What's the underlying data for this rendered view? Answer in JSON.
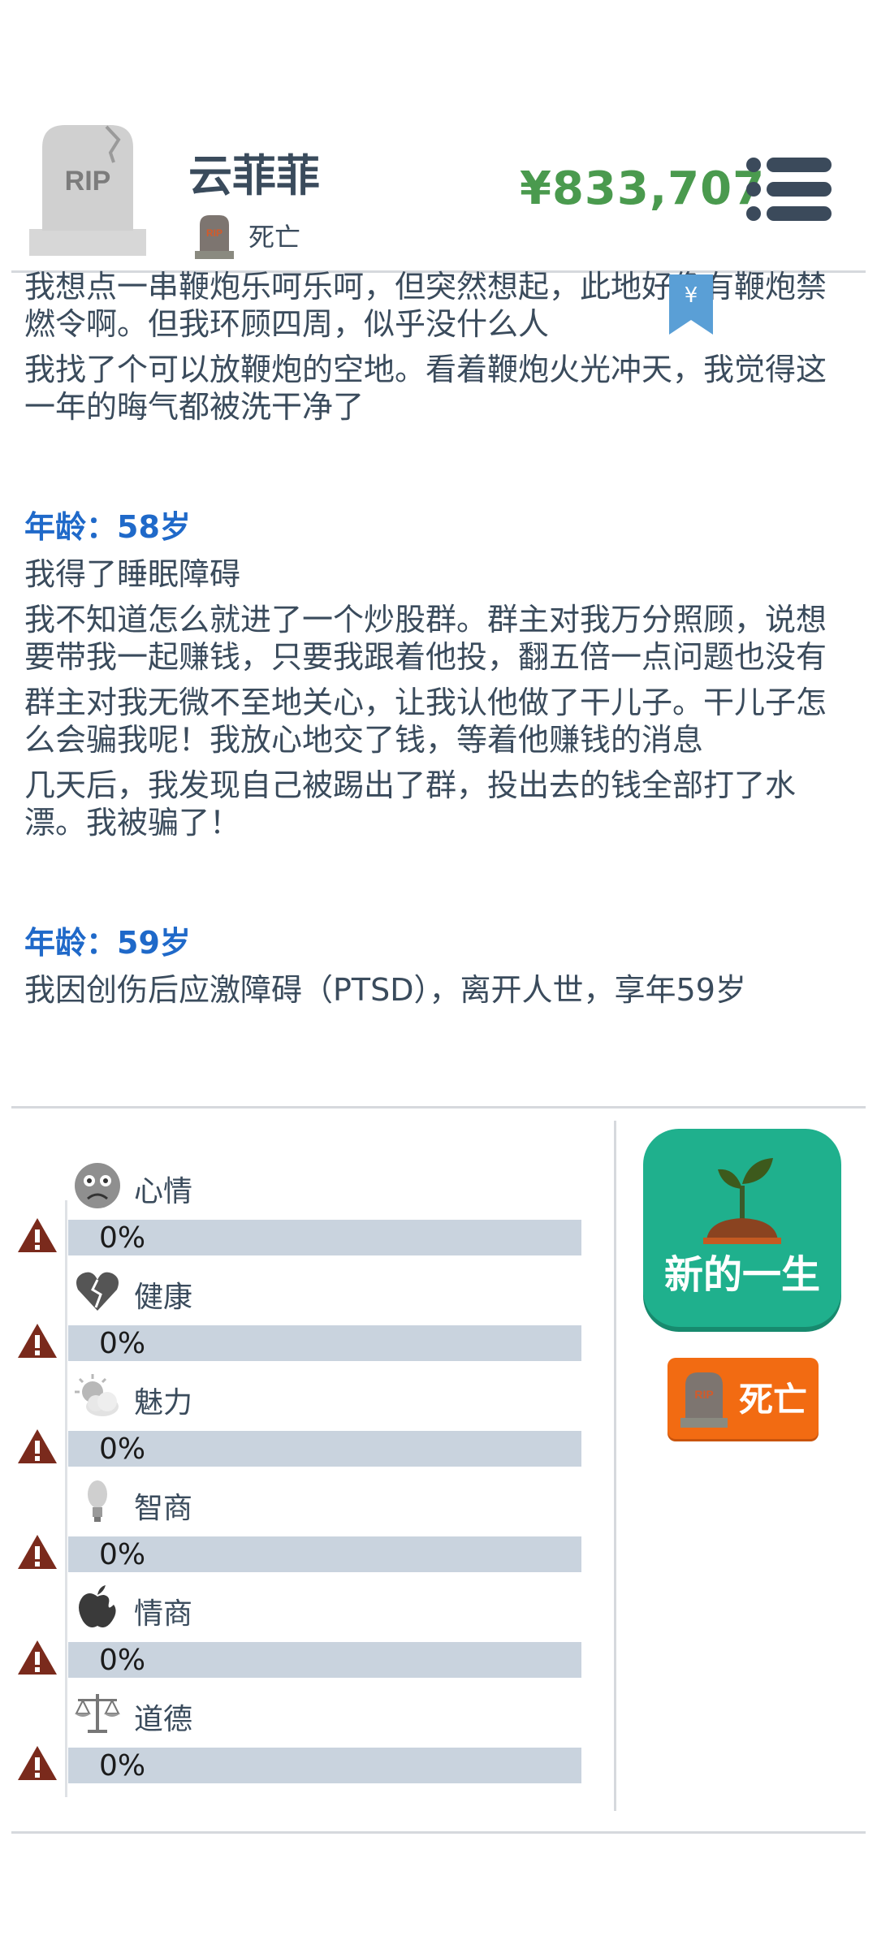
{
  "header": {
    "name": "云菲菲",
    "status": "死亡",
    "tomb_text": "RIP",
    "money": "¥833,707",
    "bookmark_symbol": "¥"
  },
  "story": {
    "p1": "我想点一串鞭炮乐呵乐呵，但突然想起，此地好像有鞭炮禁燃令啊。但我环顾四周，似乎没什么人",
    "p2": "我找了个可以放鞭炮的空地。看着鞭炮火光冲天，我觉得这一年的晦气都被洗干净了",
    "age58": "年龄：58岁",
    "p3": "我得了睡眠障碍",
    "p4": "我不知道怎么就进了一个炒股群。群主对我万分照顾，说想要带我一起赚钱，只要我跟着他投，翻五倍一点问题也没有",
    "p5": "群主对我无微不至地关心，让我认他做了干儿子。干儿子怎么会骗我呢！我放心地交了钱，等着他赚钱的消息",
    "p6": "几天后，我发现自己被踢出了群，投出去的钱全部打了水漂。我被骗了！",
    "age59": "年龄：59岁",
    "p7": "我因创伤后应激障碍（PTSD），离开人世，享年59岁"
  },
  "stats": [
    {
      "label": "心情",
      "value": "0%",
      "level": 0,
      "icon": "sad-face-icon"
    },
    {
      "label": "健康",
      "value": "0%",
      "level": 0,
      "icon": "broken-heart-icon"
    },
    {
      "label": "魅力",
      "value": "0%",
      "level": 0,
      "icon": "sun-cloud-icon"
    },
    {
      "label": "智商",
      "value": "0%",
      "level": 0,
      "icon": "lightbulb-icon"
    },
    {
      "label": "情商",
      "value": "0%",
      "level": 0,
      "icon": "apple-icon"
    },
    {
      "label": "道德",
      "value": "0%",
      "level": 0,
      "icon": "scales-icon"
    }
  ],
  "buttons": {
    "new_life": "新的一生",
    "death": "死亡"
  },
  "colors": {
    "money": "#4a9a4e",
    "age": "#1f69c9",
    "new_life_bg": "#1fb08d",
    "death_bg": "#f26b12",
    "bar_bg": "#c9d3de"
  }
}
